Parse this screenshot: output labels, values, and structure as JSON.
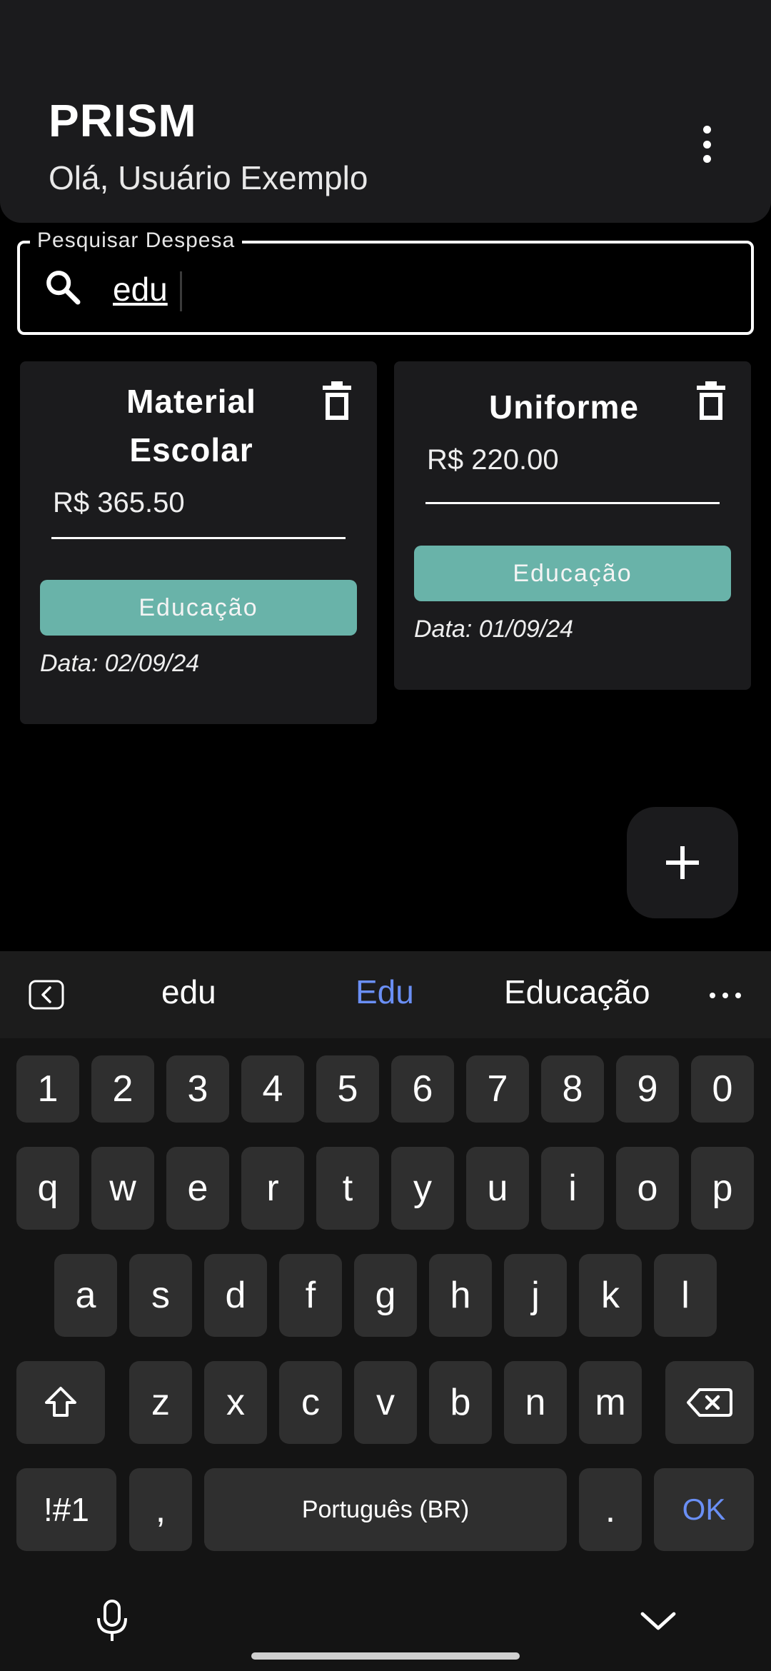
{
  "header": {
    "title": "PRISM",
    "greeting": "Olá, Usuário Exemplo"
  },
  "search": {
    "label": "Pesquisar Despesa",
    "value": "edu"
  },
  "cards": [
    {
      "title_line1": "Material",
      "title_line2": "Escolar",
      "price": "R$ 365.50",
      "category": "Educação",
      "date": "Data: 02/09/24"
    },
    {
      "title": "Uniforme",
      "price": "R$ 220.00",
      "category": "Educação",
      "date": "Data: 01/09/24"
    }
  ],
  "keyboard": {
    "suggestions": [
      "edu",
      "Edu",
      "Educação"
    ],
    "row_numbers": [
      "1",
      "2",
      "3",
      "4",
      "5",
      "6",
      "7",
      "8",
      "9",
      "0"
    ],
    "row1": [
      "q",
      "w",
      "e",
      "r",
      "t",
      "y",
      "u",
      "i",
      "o",
      "p"
    ],
    "row2": [
      "a",
      "s",
      "d",
      "f",
      "g",
      "h",
      "j",
      "k",
      "l"
    ],
    "row3": [
      "z",
      "x",
      "c",
      "v",
      "b",
      "n",
      "m"
    ],
    "symbols": "!#1",
    "comma": ",",
    "space": "Português (BR)",
    "period": ".",
    "ok": "OK"
  },
  "colors": {
    "accent_category": "#69b3a9",
    "suggestion_highlight": "#6a8ff5"
  }
}
